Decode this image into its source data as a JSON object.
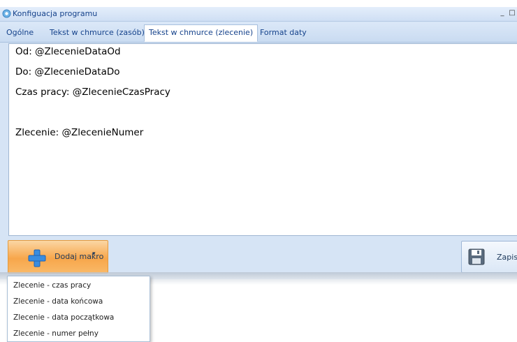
{
  "window": {
    "title": "Konfiguacja programu",
    "minimize_label": "_",
    "maximize_label": "□"
  },
  "tabs": [
    {
      "label": "Ogólne",
      "active": false
    },
    {
      "label": "Tekst w chmurce (zasób)",
      "active": false
    },
    {
      "label": "Tekst w chmurce (zlecenie)",
      "active": true
    },
    {
      "label": "Format daty",
      "active": false
    }
  ],
  "editor": {
    "lines": [
      "Od: @ZlecenieDataOd",
      "Do: @ZlecenieDataDo",
      "Czas pracy: @ZlecenieCzasPracy",
      "Zlecenie: @ZlecenieNumer"
    ]
  },
  "toolbar": {
    "add_macro_label": "Dodaj makro",
    "add_macro_arrow": "▾",
    "save_label": "Zapis"
  },
  "macro_menu": {
    "items": [
      "Zlecenie - czas pracy",
      "Zlecenie - data końcowa",
      "Zlecenie - data początkowa",
      "Zlecenie - numer pełny"
    ]
  },
  "colors": {
    "accent": "#f7a64b",
    "chrome": "#d6e4f5",
    "text": "#15428b"
  },
  "icons": {
    "app": "gear-icon",
    "add": "plus-icon",
    "save": "floppy-disk-icon"
  }
}
